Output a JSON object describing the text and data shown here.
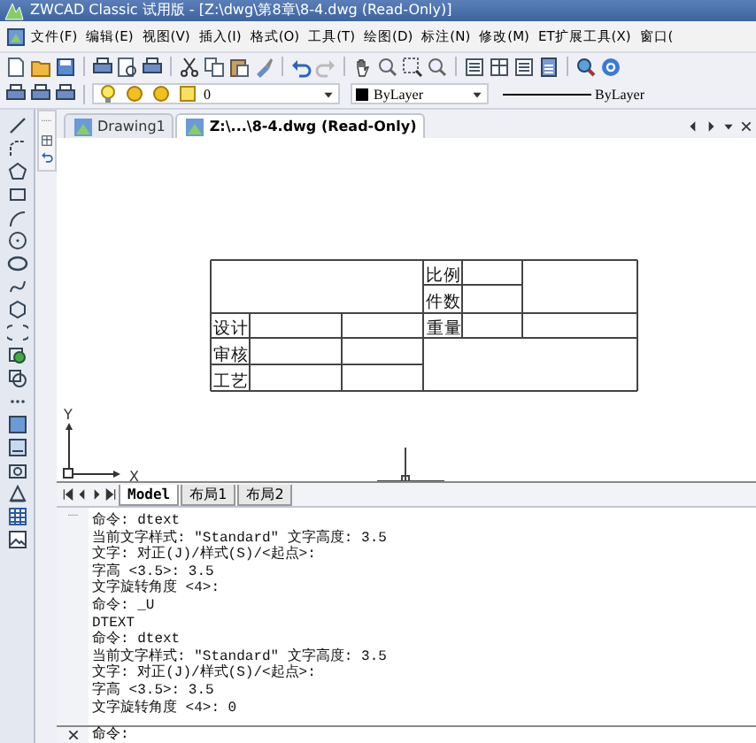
{
  "window": {
    "title": "ZWCAD Classic 试用版 - [Z:\\dwg\\第8章\\8-4.dwg (Read-Only)]"
  },
  "menu": [
    "文件(F)",
    "编辑(E)",
    "视图(V)",
    "插入(I)",
    "格式(O)",
    "工具(T)",
    "绘图(D)",
    "标注(N)",
    "修改(M)",
    "ET扩展工具(X)",
    "窗口("
  ],
  "properties_toolbar": {
    "layer": "0",
    "color_setting": "ByLayer",
    "linetype": "ByLayer"
  },
  "document_tabs": [
    {
      "label": "Drawing1",
      "selected": false
    },
    {
      "label": "Z:\\...\\8-4.dwg (Read-Only)",
      "selected": true
    }
  ],
  "drawing": {
    "title_block_labels": [
      "比例",
      "件数",
      "设计",
      "重量",
      "审核",
      "工艺"
    ],
    "ucs": {
      "x_label": "X",
      "y_label": "Y"
    }
  },
  "layout_tabs": [
    {
      "label": "Model",
      "selected": true
    },
    {
      "label": "布局1",
      "selected": false
    },
    {
      "label": "布局2",
      "selected": false
    }
  ],
  "command_history": [
    "命令: dtext",
    "当前文字样式: \"Standard\" 文字高度: 3.5",
    "文字: 对正(J)/样式(S)/<起点>:",
    "字高 <3.5>: 3.5",
    "文字旋转角度 <4>:",
    "命令: _U",
    "DTEXT",
    "命令: dtext",
    "当前文字样式: \"Standard\" 文字高度: 3.5",
    "文字: 对正(J)/样式(S)/<起点>:",
    "字高 <3.5>: 3.5",
    "文字旋转角度 <4>: 0"
  ],
  "command_line": {
    "prompt": "命令:"
  }
}
